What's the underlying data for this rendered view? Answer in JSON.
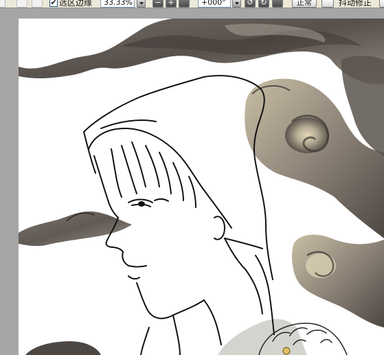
{
  "toolbar": {
    "selection_edge_label": "选区边缘",
    "selection_edge_checked": true,
    "zoom_value": "33.33%",
    "rotation_value": "+000°",
    "blend_mode": "正常",
    "stabilizer_label": "抖动修正"
  },
  "icons": {
    "checkbox_mark": "✔",
    "zoom_out": "−",
    "zoom_in": "+",
    "rotate_left": "↺",
    "rotate_right": "↻"
  },
  "colors": {
    "toolbar_bg": "#ece9d8",
    "workspace_bg": "#a6a6a6",
    "canvas_bg": "#ffffff",
    "smoke_dark": "#4f4741",
    "smoke_mid": "#7a716a",
    "smoke_light": "#c9bfa7",
    "lineart": "#111111"
  }
}
